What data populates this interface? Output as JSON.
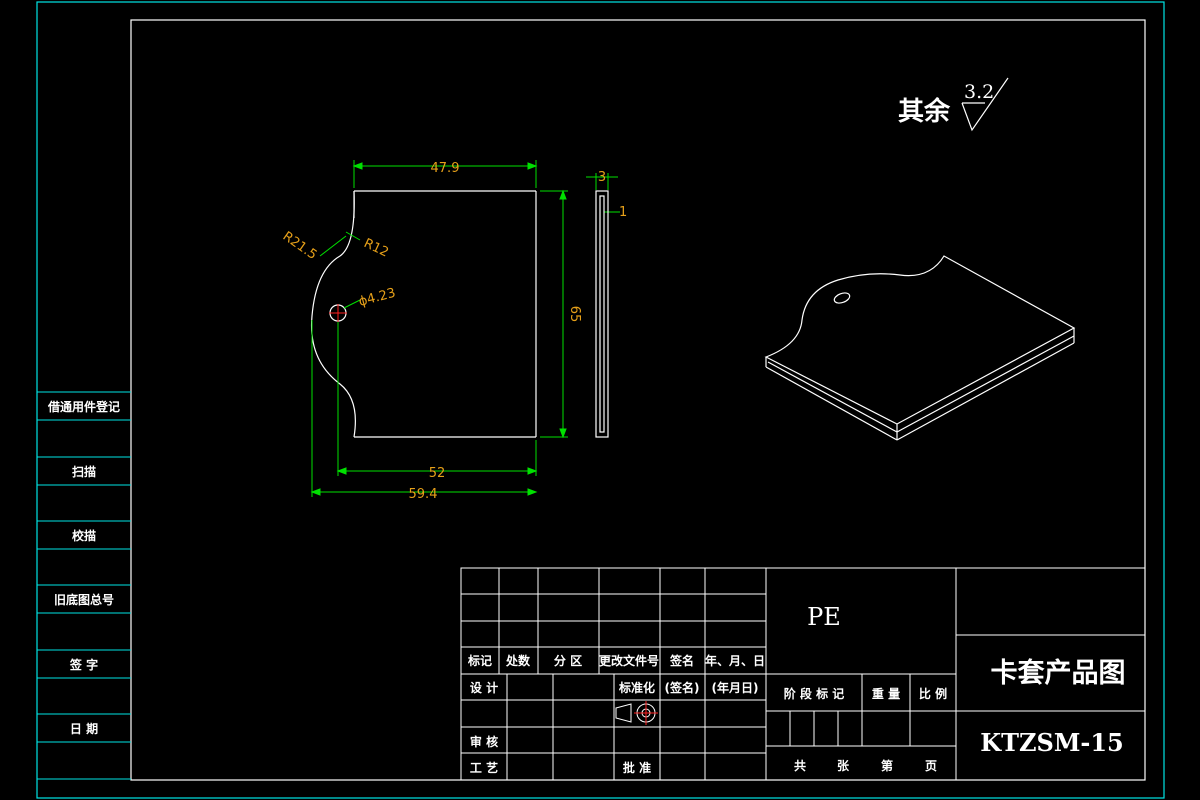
{
  "surface_finish": {
    "label": "其余",
    "roughness": "3.2"
  },
  "dimensions": {
    "width_top": "47.9",
    "height": "65",
    "thickness": "3",
    "groove": "1",
    "radius_large": "R21.5",
    "radius_small": "R12",
    "hole": "ϕ4.23",
    "width_bottom": "52",
    "overall_width": "59.4"
  },
  "left_strip": {
    "items": [
      "借通用件登记",
      "扫描",
      "校描",
      "旧底图总号",
      "签 字",
      "日 期"
    ]
  },
  "title_block": {
    "material": "PE",
    "drawing_title": "卡套产品图",
    "drawing_number": "KTZSM-15",
    "rev_headers": [
      "标记",
      "处数",
      "分 区",
      "更改文件号",
      "签名",
      "年、月、日"
    ],
    "design_label": "设 计",
    "standardize_label": "标准化",
    "sign_label": "(签名)",
    "date_label": "(年月日)",
    "review_label": "审 核",
    "process_label": "工 艺",
    "approve_label": "批 准",
    "stage_label": "阶 段 标 记",
    "weight_label": "重 量",
    "scale_label": "比 例",
    "total_label": "共",
    "sheets_label": "张",
    "page_label": "第",
    "page_suffix": "页"
  },
  "colors": {
    "frame": "#00e5e5",
    "geometry": "#ffffff",
    "dimension_line": "#00e000",
    "dimension_text": "#e6a019",
    "center_mark": "#ff2020"
  }
}
